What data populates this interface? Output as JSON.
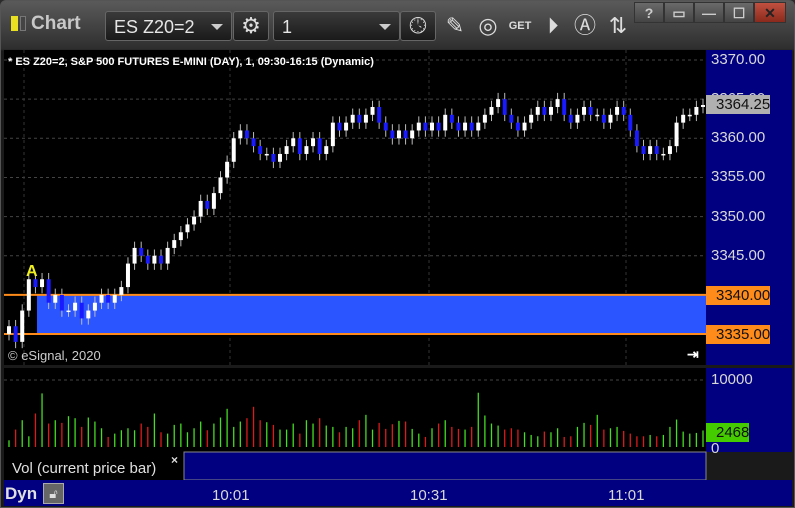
{
  "window": {
    "title": "Chart",
    "help": "?",
    "buttons": [
      "help",
      "link",
      "minimize",
      "maximize",
      "close"
    ]
  },
  "toolbar": {
    "symbol": "ES Z20=2",
    "interval": "1",
    "icons": [
      "settings-icon",
      "clock-icon",
      "pencil-icon",
      "study-icon",
      "get-icon",
      "play-icon",
      "alert-icon",
      "sync-icon"
    ]
  },
  "chart": {
    "heading": "* ES Z20=2, S&P 500 FUTURES E-MINI (DAY), 1, 09:30-16:15 (Dynamic)",
    "copyright": "© eSignal, 2020",
    "marker": "A",
    "price_labels": [
      "3370.00",
      "3365.00",
      "3360.00",
      "3355.00",
      "3350.00",
      "3345.00"
    ],
    "price_ticks": [
      3370,
      3365,
      3360,
      3355,
      3350,
      3345
    ],
    "last_price": "3364.25",
    "zone_high": "3340.00",
    "zone_low": "3335.00",
    "zone": [
      3335,
      3340
    ],
    "ylim": [
      3333,
      3372
    ],
    "colors": {
      "up": "#ffffff",
      "down": "#1a1aff",
      "zone": "#2a55ff",
      "zone_line": "#ff8c1a",
      "axis_bg": "#000080",
      "last_tag": "#b0b0b0",
      "vol_tag": "#44cc00",
      "vol_up": "#44dd22",
      "vol_down": "#dd1a1a"
    },
    "closes": [
      3336,
      3334,
      3338,
      3342,
      3341,
      3342,
      3339,
      3340,
      3338,
      3338,
      3339,
      3337,
      3338,
      3339,
      3340,
      3339,
      3340,
      3341,
      3344,
      3346,
      3345,
      3344,
      3345,
      3344,
      3346,
      3347,
      3348,
      3349,
      3350,
      3352,
      3351,
      3353,
      3355,
      3357,
      3360,
      3361,
      3360,
      3359,
      3358,
      3358,
      3357,
      3358,
      3359,
      3360,
      3358,
      3359,
      3360,
      3358,
      3359,
      3362,
      3361,
      3362,
      3363,
      3362,
      3363,
      3364,
      3362,
      3361,
      3360,
      3361,
      3360,
      3361,
      3362,
      3361,
      3362,
      3361,
      3363,
      3362,
      3361,
      3362,
      3361,
      3362,
      3363,
      3364,
      3365,
      3363,
      3362,
      3361,
      3362,
      3363,
      3364,
      3363,
      3364,
      3365,
      3363,
      3362,
      3363,
      3364,
      3363,
      3363,
      3362,
      3363,
      3364,
      3363,
      3361,
      3359,
      3358,
      3359,
      3358,
      3358,
      3359,
      3362,
      3363,
      3363,
      3364,
      3364.25
    ]
  },
  "volume": {
    "label": "Vol (current price bar)",
    "close_label": "×",
    "axis_labels": [
      "10000",
      "0"
    ],
    "current": "2468",
    "ylim": [
      0,
      11000
    ],
    "values": [
      1000,
      2600,
      4000,
      1600,
      5000,
      8000,
      3500,
      4000,
      3600,
      4600,
      4300,
      3000,
      4400,
      3800,
      2800,
      1500,
      2000,
      2500,
      2800,
      2500,
      3500,
      3000,
      5000,
      2200,
      2000,
      3300,
      3500,
      2200,
      2800,
      3800,
      2500,
      3500,
      4400,
      5700,
      3000,
      3800,
      4300,
      6000,
      4000,
      3700,
      3300,
      2600,
      2600,
      3500,
      2000,
      4000,
      3500,
      4300,
      3200,
      3000,
      2200,
      3000,
      2800,
      4000,
      4800,
      2600,
      3600,
      2700,
      3400,
      3900,
      3800,
      2700,
      2000,
      1500,
      2800,
      3500,
      4000,
      3000,
      2700,
      2600,
      3000,
      8100,
      4700,
      3500,
      3200,
      2600,
      2800,
      2600,
      2200,
      1800,
      1600,
      2300,
      2200,
      2800,
      1500,
      1600,
      3000,
      3600,
      3300,
      4800,
      2600,
      2800,
      3000,
      2400,
      2000,
      1600,
      1600,
      1800,
      1600,
      1800,
      3000,
      4100,
      2300,
      2000,
      2100,
      2468
    ]
  },
  "time_axis": {
    "labels": [
      "10:01",
      "10:31",
      "11:01"
    ],
    "mode": "Dyn"
  }
}
